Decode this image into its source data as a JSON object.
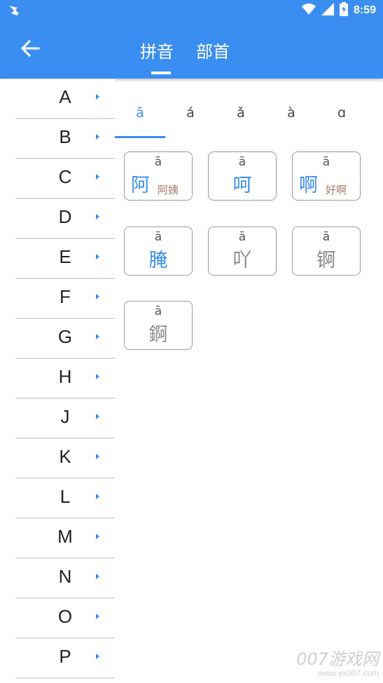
{
  "status_bar": {
    "time": "8:59",
    "icons": [
      "app-notification-icon",
      "wifi-icon",
      "signal-icon",
      "battery-icon"
    ]
  },
  "header": {
    "back_icon": "arrow-left-icon",
    "tabs": [
      {
        "label": "拼音",
        "selected": true
      },
      {
        "label": "部首",
        "selected": false
      }
    ]
  },
  "letters": [
    "A",
    "B",
    "C",
    "D",
    "E",
    "F",
    "G",
    "H",
    "J",
    "K",
    "L",
    "M",
    "N",
    "O",
    "P"
  ],
  "tones": [
    {
      "label": "ā",
      "selected": true
    },
    {
      "label": "á",
      "selected": false
    },
    {
      "label": "ǎ",
      "selected": false
    },
    {
      "label": "à",
      "selected": false
    },
    {
      "label": "ɑ",
      "selected": false
    }
  ],
  "characters": [
    {
      "pinyin": "ā",
      "char": "阿",
      "word": "阿姨",
      "color": "blue"
    },
    {
      "pinyin": "ā",
      "char": "呵",
      "word": "",
      "color": "blue"
    },
    {
      "pinyin": "ā",
      "char": "啊",
      "word": "好啊",
      "color": "blue"
    },
    {
      "pinyin": "ā",
      "char": "腌",
      "word": "",
      "color": "blue"
    },
    {
      "pinyin": "ā",
      "char": "吖",
      "word": "",
      "color": "gray"
    },
    {
      "pinyin": "ā",
      "char": "锕",
      "word": "",
      "color": "gray"
    },
    {
      "pinyin": "ā",
      "char": "錒",
      "word": "",
      "color": "gray"
    }
  ],
  "watermark": {
    "main": "007游戏网",
    "sub": "www.yx007.com"
  },
  "colors": {
    "accent": "#3a8ef2",
    "word": "#a07a66",
    "inactive_char": "#888888"
  }
}
